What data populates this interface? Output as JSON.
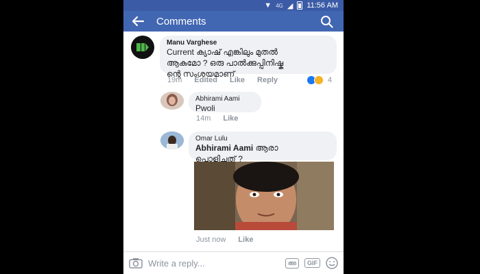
{
  "status_bar": {
    "network": "4G",
    "time": "11:56 AM"
  },
  "header": {
    "title": "Comments"
  },
  "comments": [
    {
      "name": "Manu Varghese",
      "text_lines": [
        "Current ക്യാഷ് എങ്കിലും മുതൽ",
        "ആകുമോ ? ഒരു പാൽക്കുപ്പിനിഷ്കു",
        "ന്റെ സംശയമാണ്"
      ],
      "time": "19m",
      "edited": "Edited",
      "like": "Like",
      "reply": "Reply",
      "reactions_count": "4"
    },
    {
      "name": "Abhirami Aami",
      "text": "Pwoli",
      "time": "14m",
      "like": "Like"
    },
    {
      "name": "Omar Lulu",
      "mention": "Abhirami Aami",
      "text_rest": " ആരാ",
      "text_line2": "പൊളിച്ചത് ?",
      "time": "Just now",
      "like": "Like"
    }
  ],
  "composer": {
    "placeholder": "Write a reply..."
  },
  "colors": {
    "header": "#4267b2",
    "bubble": "#f0f1f4"
  }
}
